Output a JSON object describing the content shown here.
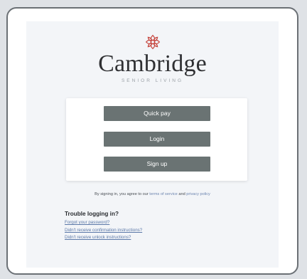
{
  "brand": {
    "name": "Cambridge",
    "tagline": "SENIOR LIVING",
    "logo_icon": "flower-icon",
    "logo_color": "#c6463f"
  },
  "buttons": {
    "quick_pay": "Quick pay",
    "login": "Login",
    "sign_up": "Sign up"
  },
  "agreement": {
    "prefix": "By signing in, you agree to our",
    "terms_link": "terms of service",
    "and": "and",
    "privacy_link": "privacy policy"
  },
  "trouble": {
    "title": "Trouble logging in?",
    "links": [
      "Forgot your password?",
      "Didn't receive confirmation instructions?",
      "Didn't receive unlock instructions?"
    ]
  },
  "colors": {
    "button_bg": "#6a7373",
    "panel_bg": "#f3f5f8",
    "link": "#5b78a8"
  }
}
